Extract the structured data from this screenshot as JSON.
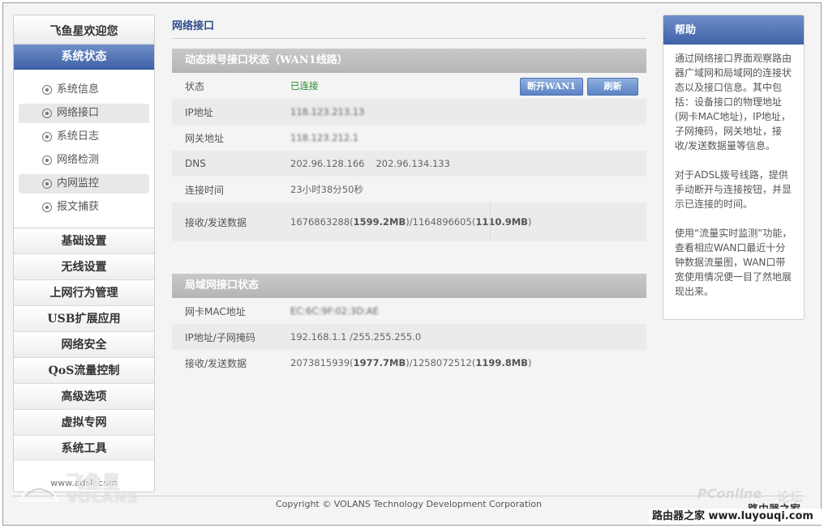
{
  "sidebar": {
    "welcome": "飞鱼星欢迎您",
    "active_section": "系统状态",
    "sub_items": [
      {
        "label": "系统信息",
        "highlight": false
      },
      {
        "label": "网络接口",
        "highlight": true
      },
      {
        "label": "系统日志",
        "highlight": false
      },
      {
        "label": "网络检测",
        "highlight": false
      },
      {
        "label": "内网监控",
        "highlight": true
      },
      {
        "label": "报文捕获",
        "highlight": false
      }
    ],
    "sections": [
      "基础设置",
      "无线设置",
      "上网行为管理",
      "USB扩展应用",
      "网络安全",
      "QoS流量控制",
      "高级选项",
      "虚拟专网",
      "系统工具"
    ],
    "url": "www.adslr.com"
  },
  "main": {
    "title": "网络接口",
    "wan": {
      "header": "动态拨号接口状态（WAN1线路）",
      "status_label": "状态",
      "status_value": "已连接",
      "disconnect_button": "断开WAN1",
      "refresh_button": "刷新",
      "ip_label": "IP地址",
      "ip_value": "118.123.213.13",
      "gateway_label": "网关地址",
      "gateway_value": "118.123.212.1",
      "dns_label": "DNS",
      "dns_value_1": "202.96.128.166",
      "dns_value_2": "202.96.134.133",
      "uptime_label": "连接时间",
      "uptime_value": "23小时38分50秒",
      "traffic_label": "接收/发送数据",
      "rx_bytes": "1676863288",
      "rx_mb": "1599.2MB",
      "tx_bytes": "1164896605",
      "tx_mb": "1110.9MB"
    },
    "lan": {
      "header": "局域网接口状态",
      "mac_label": "网卡MAC地址",
      "mac_value": "EC:6C:9F:02:3D:AE",
      "ip_label": "IP地址/子网掩码",
      "ip_value": "192.168.1.1 /255.255.255.0",
      "traffic_label": "接收/发送数据",
      "rx_bytes": "2073815939",
      "rx_mb": "1977.7MB",
      "tx_bytes": "1258072512",
      "tx_mb": "1199.8MB"
    }
  },
  "help": {
    "title": "帮助",
    "paragraphs": [
      "通过网络接口界面观察路由器广域网和局域网的连接状态以及接口信息。其中包括：设备接口的物理地址(网卡MAC地址)，IP地址，子网掩码，网关地址，接收/发送数据量等信息。",
      "对于ADSL拨号线路，提供手动断开与连接按钮，并显示已连接的时间。",
      "使用“流量实时监测”功能，查看相应WAN口最近十分钟数据流量图，WAN口带宽使用情况便一目了然地展现出来。"
    ]
  },
  "footer": {
    "copyright": "Copyright © VOLANS Technology Development Corporation"
  },
  "watermarks": {
    "logo_cn": "飞鱼星",
    "logo_en": "VOLANS",
    "pconline": "PConline",
    "forum": "论坛",
    "site_cn": "路由器之家",
    "site_bar": "路由器之家 www.luyouqi.com"
  }
}
